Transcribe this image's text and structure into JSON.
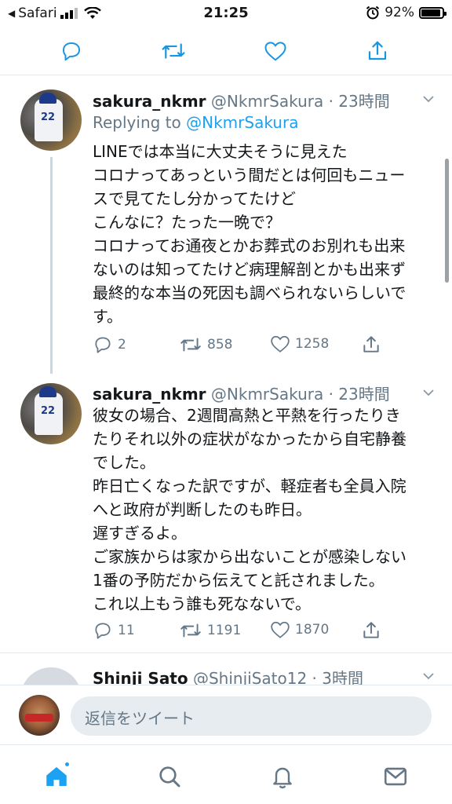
{
  "status_bar": {
    "back_app": "Safari",
    "time": "21:25",
    "battery_percent": "92%",
    "battery_level": 0.92
  },
  "tweets": [
    {
      "display_name": "sakura_nkmr",
      "handle_time": "@NkmrSakura · 23時間",
      "replying_prefix": "Replying to ",
      "replying_handle": "@NkmrSakura",
      "lines": [
        "LINEでは本当に大丈夫そうに見えた",
        "コロナってあっという間だとは何回もニュー",
        "スで見てたし分かってたけど",
        "こんなに？たった一晩で？",
        "コロナってお通夜とかお葬式のお別れも出来",
        "ないのは知ってたけど病理解剖とかも出来ず",
        "最終的な本当の死因も調べられないらしいで",
        "す。"
      ],
      "replies": "2",
      "retweets": "858",
      "likes": "1258"
    },
    {
      "display_name": "sakura_nkmr",
      "handle_time": "@NkmrSakura · 23時間",
      "lines": [
        "彼女の場合、2週間高熱と平熱を行ったりき",
        "たりそれ以外の症状がなかったから自宅静養",
        "でした。",
        "昨日亡くなった訳ですが、軽症者も全員入院",
        "へと政府が判断したのも昨日。",
        "遅すぎるよ。",
        "ご家族からは家から出ないことが感染しない",
        "1番の予防だから伝えてと託されました。",
        "これ以上もう誰も死なないで。"
      ],
      "replies": "11",
      "retweets": "1191",
      "likes": "1870"
    },
    {
      "display_name": "Shinji Sato",
      "handle_time": "@ShinjiSato12 · 3時間"
    }
  ],
  "composer": {
    "placeholder": "返信をツイート"
  },
  "colors": {
    "accent": "#1da1f2",
    "icon_blue": "#1b95e0",
    "muted": "#657786",
    "divider": "#e1e8ed"
  }
}
